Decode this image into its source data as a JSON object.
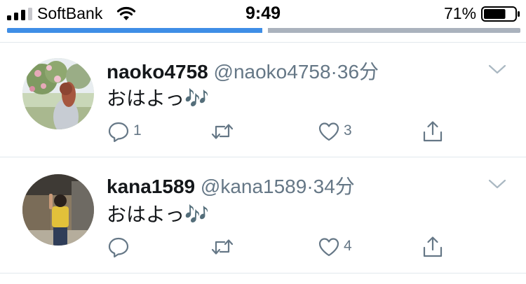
{
  "status_bar": {
    "carrier": "SoftBank",
    "time": "9:49",
    "battery_percent": "71%",
    "battery_level": 0.71,
    "signal_bars_filled": 3,
    "icons": [
      "signal-icon",
      "wifi-icon",
      "battery-icon"
    ]
  },
  "progress": {
    "value": 0.5
  },
  "tweets": [
    {
      "name": "naoko4758",
      "handle": "@naoko4758",
      "separator": "·",
      "time": "36分",
      "text": "おはよっ🎶",
      "reply_count": "1",
      "retweet_count": "",
      "like_count": "3"
    },
    {
      "name": "kana1589",
      "handle": "@kana1589",
      "separator": "·",
      "time": "34分",
      "text": "おはよっ🎶",
      "reply_count": "",
      "retweet_count": "",
      "like_count": "4"
    }
  ],
  "colors": {
    "accent": "#3f8ee6",
    "secondary_text": "#657786",
    "divider": "#e1e8ed"
  }
}
